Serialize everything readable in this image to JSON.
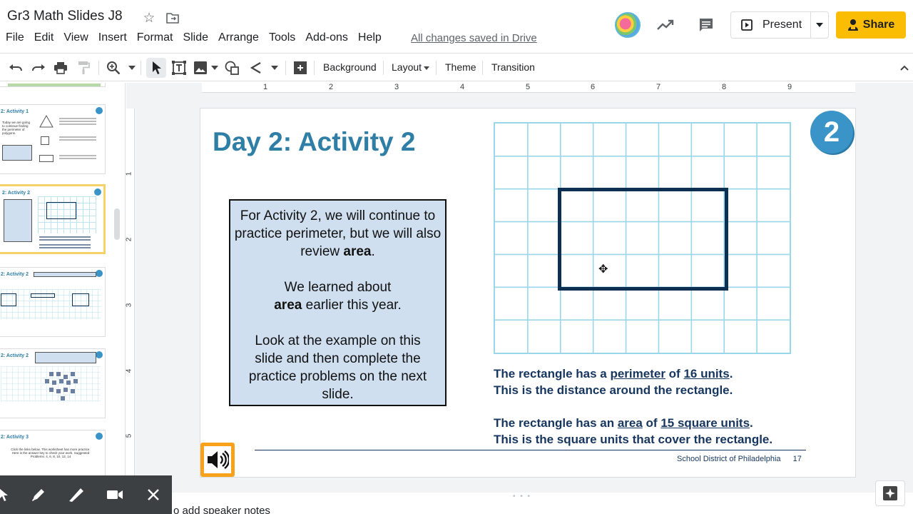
{
  "app": {
    "doc_title": "Gr3 Math Slides J8",
    "save_status": "All changes saved in Drive"
  },
  "menu": [
    "File",
    "Edit",
    "View",
    "Insert",
    "Format",
    "Slide",
    "Arrange",
    "Tools",
    "Add-ons",
    "Help"
  ],
  "header": {
    "present_label": "Present",
    "share_label": "Share",
    "icons": [
      "star-icon",
      "move-to-folder-icon",
      "activity-trend-icon",
      "comments-icon",
      "present-icon",
      "share-lock-icon"
    ]
  },
  "toolbar": {
    "background_label": "Background",
    "layout_label": "Layout",
    "theme_label": "Theme",
    "transition_label": "Transition",
    "icons": [
      "undo-icon",
      "redo-icon",
      "print-icon",
      "paint-format-icon",
      "zoom-icon",
      "select-icon",
      "text-box-icon",
      "image-icon",
      "shape-icon",
      "line-icon",
      "add-comment-icon",
      "collapse-icon"
    ]
  },
  "ruler": {
    "top_ticks": [
      "1",
      "2",
      "3",
      "4",
      "5",
      "6",
      "7",
      "8",
      "9"
    ],
    "left_ticks": [
      "1",
      "2",
      "3",
      "4",
      "5"
    ]
  },
  "filmstrip": {
    "slides": [
      {
        "title": "2: Activity 1",
        "text": "Today we are going to continue finding the perimeter of polygons.",
        "selected": false
      },
      {
        "title": "2: Activity 2",
        "text": "For Activity 2, we will continue to practice perimeter, but we will also review area.",
        "selected": true
      },
      {
        "title": "2: Activity 2",
        "text": "For each rectangle, identify the area and perimeter!",
        "selected": false
      },
      {
        "title": "2: Activity 2",
        "text": "Drag some of the purple unit squares onto the grid to create a polygon.",
        "selected": false
      },
      {
        "title": "2: Activity 3",
        "text": "Click the links below. This worksheet has more practice. Here is the answer key to check your work. Suggested Problems: 4, 6, 8, 10, 12, 14",
        "selected": false
      }
    ]
  },
  "slide": {
    "title": "Day 2: Activity 2",
    "badge_number": "2",
    "box": {
      "p1_text": "For Activity 2, we will continue to practice perimeter, but we will also review ",
      "p1_bold": "area",
      "p1_end": ".",
      "p2_text": "We learned about",
      "p2_bold": "area",
      "p2_end": " earlier this year.",
      "p3_text": "Look at the example on this slide and then complete the practice problems on the next slide."
    },
    "statement1": {
      "prefix": "The rectangle has a ",
      "term": "perimeter",
      "mid": " of ",
      "value": "16 units",
      "end": ".",
      "line2": "This is the distance around the rectangle."
    },
    "statement2": {
      "prefix": "The rectangle has an ",
      "term": "area",
      "mid": " of ",
      "value": "15 square units",
      "end": ".",
      "line2": "This is the square units that cover the rectangle."
    },
    "footer_org": "School District of Philadelphia",
    "page_number": "17"
  },
  "bottom": {
    "notes_hint": "o add speaker notes"
  },
  "colors": {
    "title_blue": "#2f7ea6",
    "navy": "#16365f",
    "grid_line": "#9ad6ea",
    "box_fill": "#cfdff0",
    "share_yellow": "#fbbc04",
    "speaker_orange": "#f8a21c"
  }
}
